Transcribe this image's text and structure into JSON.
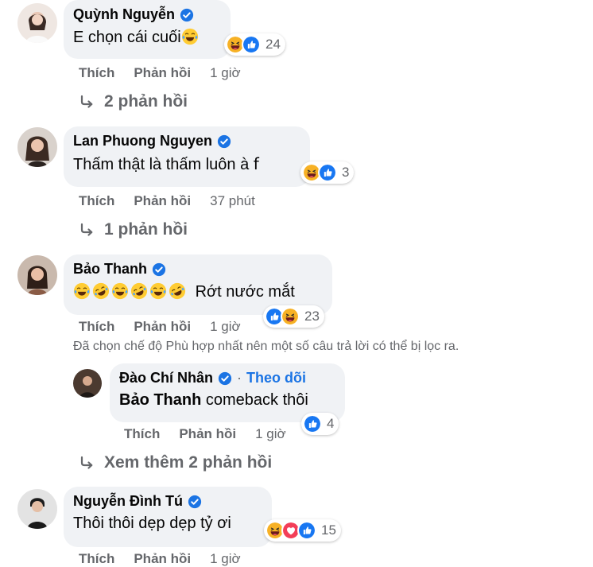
{
  "colors": {
    "accent": "#1b74e4",
    "bubble": "#f0f2f5",
    "muted": "#65676b"
  },
  "labels": {
    "like": "Thích",
    "reply": "Phản hồi"
  },
  "comments": [
    {
      "author": "Quỳnh Nguyễn",
      "text": "E chọn cái cuối",
      "time": "1 giờ",
      "reaction_count": "24",
      "replies_label": "2 phản hồi"
    },
    {
      "author": "Lan Phuong Nguyen",
      "text": "Thấm thật là thấm luôn à 𝖿",
      "time": "37 phút",
      "reaction_count": "3",
      "replies_label": "1 phản hồi"
    },
    {
      "author": "Bảo Thanh",
      "text": "Rớt nước mắt",
      "time": "1 giờ",
      "reaction_count": "23"
    },
    {
      "author": "Nguyễn Đình Tú",
      "text": "Thôi thôi dẹp dẹp tỷ ơi",
      "time": "1 giờ",
      "reaction_count": "15"
    }
  ],
  "filter_notice": "Đã chọn chế độ Phù hợp nhất nên một số câu trả lời có thể bị lọc ra.",
  "reply": {
    "author": "Đào Chí Nhân",
    "follow": "Theo dõi",
    "tag": "Bảo Thanh",
    "text": " comeback thôi",
    "time": "1 giờ",
    "reaction_count": "4"
  },
  "more_replies": "Xem thêm 2 phản hồi"
}
